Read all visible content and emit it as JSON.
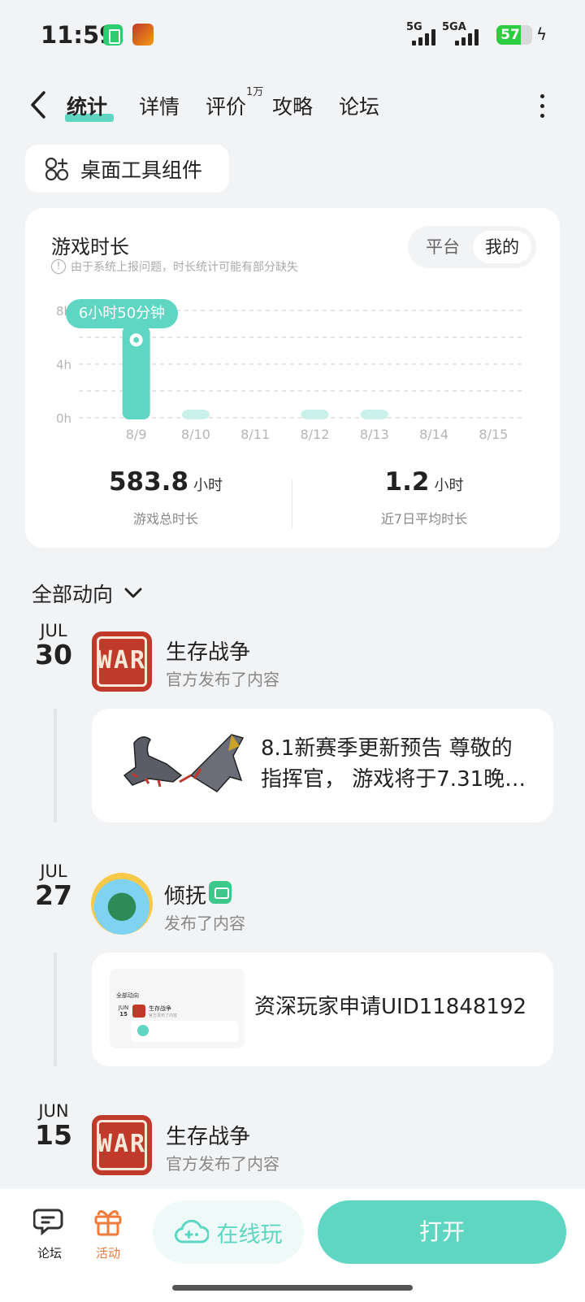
{
  "status_bar": {
    "time": "11:59",
    "signal1": "5G",
    "signal2": "5GA",
    "battery": "57",
    "colors": {
      "battery": "#2ecc40"
    }
  },
  "nav": {
    "tabs": [
      {
        "label": "统计",
        "active": true
      },
      {
        "label": "详情",
        "active": false
      },
      {
        "label": "评价",
        "active": false,
        "badge": "1万"
      },
      {
        "label": "攻略",
        "active": false
      },
      {
        "label": "论坛",
        "active": false
      }
    ]
  },
  "widget_button": {
    "label": "桌面工具组件",
    "icon": "widgets-icon"
  },
  "stats": {
    "title": "游戏时长",
    "note": "由于系统上报问题，时长统计可能有部分缺失",
    "toggle": {
      "options": [
        "平台",
        "我的"
      ],
      "selected": "我的"
    },
    "tooltip": "6小时50分钟",
    "total_value": "583.8",
    "total_unit": "小时",
    "total_caption": "游戏总时长",
    "avg_value": "1.2",
    "avg_unit": "小时",
    "avg_caption": "近7日平均时长"
  },
  "chart_data": {
    "type": "bar",
    "categories": [
      "8/9",
      "8/10",
      "8/11",
      "8/12",
      "8/13",
      "8/14",
      "8/15"
    ],
    "values": [
      6.83,
      0.45,
      0,
      0.25,
      0.25,
      0,
      0
    ],
    "y_ticks": [
      "0h",
      "4h",
      "8h"
    ],
    "ylim": [
      0,
      8
    ],
    "grid": true,
    "colors": {
      "active": "#5fd6c2",
      "inactive": "#c9f0e9"
    }
  },
  "feed": {
    "filter_label": "全部动向",
    "items": [
      {
        "month": "JUL",
        "day": "30",
        "name": "生存战争",
        "subtitle": "官方发布了内容",
        "avatar_text": "WAR",
        "post": "8.1新赛季更新预告 尊敬的指挥官， 游戏将于7.31晚…",
        "post_line1": "8.1新赛季更新预告 尊敬的",
        "post_line2": "指挥官， 游戏将于7.31晚…"
      },
      {
        "month": "JUL",
        "day": "27",
        "name": "倾抚",
        "subtitle": "发布了内容",
        "post": "资深玩家申请UID11848192",
        "thumb": {
          "filter": "全部动向",
          "date_mon": "JUN",
          "date_day": "15",
          "game": "生存战争",
          "sub": "官方发布了内容"
        }
      },
      {
        "month": "JUN",
        "day": "15",
        "name": "生存战争",
        "subtitle": "官方发布了内容",
        "avatar_text": "WAR"
      }
    ]
  },
  "bottom_bar": {
    "forum_label": "论坛",
    "activity_label": "活动",
    "online_label": "在线玩",
    "open_label": "打开",
    "colors": {
      "accent": "#5fd6c2",
      "activity": "#f07a3a"
    }
  }
}
